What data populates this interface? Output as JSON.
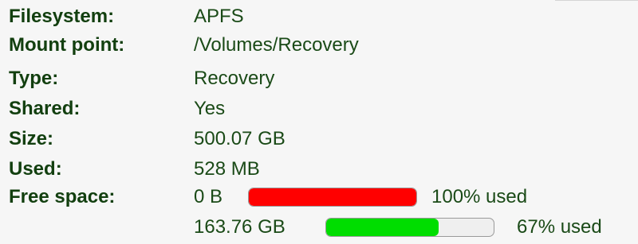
{
  "properties": [
    {
      "label": "Filesystem:",
      "value": "APFS"
    },
    {
      "label": "Mount point:",
      "value": "/Volumes/Recovery"
    },
    {
      "label": "Type:",
      "value": "Recovery"
    },
    {
      "label": "Shared:",
      "value": "Yes"
    },
    {
      "label": "Size:",
      "value": "500.07 GB"
    },
    {
      "label": "Used:",
      "value": "528 MB"
    }
  ],
  "free_space": {
    "label": "Free space:",
    "entries": [
      {
        "amount": "0 B",
        "percent_text": "100% used",
        "used_fraction": 1.0,
        "color": "#ff0000"
      },
      {
        "amount": "163.76 GB",
        "percent_text": "67% used",
        "used_fraction": 0.67,
        "color": "#00dd00"
      }
    ]
  }
}
